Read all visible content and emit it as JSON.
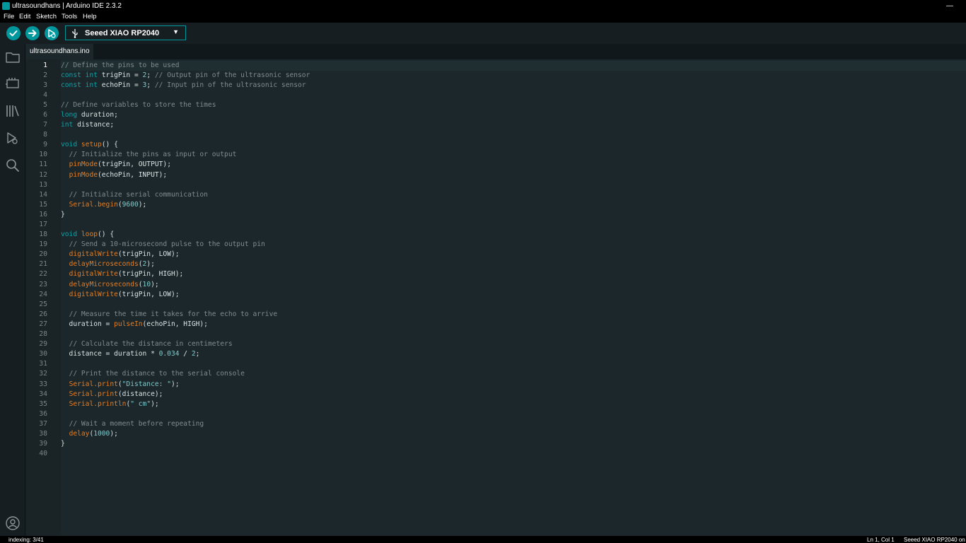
{
  "window": {
    "title": "ultrasoundhans | Arduino IDE 2.3.2",
    "minimize_glyph": "—",
    "close_glyph": "✕"
  },
  "menu": [
    "File",
    "Edit",
    "Sketch",
    "Tools",
    "Help"
  ],
  "toolbar": {
    "verify_icon": "checkmark-icon",
    "upload_icon": "arrow-right-icon",
    "debugger_icon": "debug-icon",
    "board_usb_icon": "usb-icon",
    "board_name": "Seeed XIAO RP2040",
    "board_caret": "▼"
  },
  "sidebar": {
    "items": [
      "sketchbook-icon",
      "boards-manager-icon",
      "library-manager-icon",
      "debug-icon",
      "search-icon"
    ],
    "profile_icon": "profile-icon"
  },
  "tabs": [
    {
      "label": "ultrasoundhans.ino"
    }
  ],
  "editor": {
    "active_line": 1,
    "lines": [
      [
        [
          "c",
          "// Define the pins to be used"
        ]
      ],
      [
        [
          "k",
          "const int "
        ],
        [
          "p",
          "trigPin = "
        ],
        [
          "n",
          "2"
        ],
        [
          "p",
          "; "
        ],
        [
          "c",
          "// Output pin of the ultrasonic sensor"
        ]
      ],
      [
        [
          "k",
          "const int "
        ],
        [
          "p",
          "echoPin = "
        ],
        [
          "n",
          "3"
        ],
        [
          "p",
          "; "
        ],
        [
          "c",
          "// Input pin of the ultrasonic sensor"
        ]
      ],
      [],
      [
        [
          "c",
          "// Define variables to store the times"
        ]
      ],
      [
        [
          "k",
          "long "
        ],
        [
          "p",
          "duration;"
        ]
      ],
      [
        [
          "k",
          "int "
        ],
        [
          "p",
          "distance;"
        ]
      ],
      [],
      [
        [
          "k",
          "void "
        ],
        [
          "f",
          "setup"
        ],
        [
          "p",
          "() {"
        ]
      ],
      [
        [
          "p",
          "  "
        ],
        [
          "c",
          "// Initialize the pins as input or output"
        ]
      ],
      [
        [
          "p",
          "  "
        ],
        [
          "f",
          "pinMode"
        ],
        [
          "p",
          "(trigPin, OUTPUT);"
        ]
      ],
      [
        [
          "p",
          "  "
        ],
        [
          "f",
          "pinMode"
        ],
        [
          "p",
          "(echoPin, INPUT);"
        ]
      ],
      [],
      [
        [
          "p",
          "  "
        ],
        [
          "c",
          "// Initialize serial communication"
        ]
      ],
      [
        [
          "p",
          "  "
        ],
        [
          "f",
          "Serial.begin"
        ],
        [
          "p",
          "("
        ],
        [
          "n",
          "9600"
        ],
        [
          "p",
          ");"
        ]
      ],
      [
        [
          "p",
          "}"
        ]
      ],
      [],
      [
        [
          "k",
          "void "
        ],
        [
          "f",
          "loop"
        ],
        [
          "p",
          "() {"
        ]
      ],
      [
        [
          "p",
          "  "
        ],
        [
          "c",
          "// Send a 10-microsecond pulse to the output pin"
        ]
      ],
      [
        [
          "p",
          "  "
        ],
        [
          "f",
          "digitalWrite"
        ],
        [
          "p",
          "(trigPin, LOW);"
        ]
      ],
      [
        [
          "p",
          "  "
        ],
        [
          "f",
          "delayMicroseconds"
        ],
        [
          "p",
          "("
        ],
        [
          "n",
          "2"
        ],
        [
          "p",
          ");"
        ]
      ],
      [
        [
          "p",
          "  "
        ],
        [
          "f",
          "digitalWrite"
        ],
        [
          "p",
          "(trigPin, HIGH);"
        ]
      ],
      [
        [
          "p",
          "  "
        ],
        [
          "f",
          "delayMicroseconds"
        ],
        [
          "p",
          "("
        ],
        [
          "n",
          "10"
        ],
        [
          "p",
          ");"
        ]
      ],
      [
        [
          "p",
          "  "
        ],
        [
          "f",
          "digitalWrite"
        ],
        [
          "p",
          "(trigPin, LOW);"
        ]
      ],
      [],
      [
        [
          "p",
          "  "
        ],
        [
          "c",
          "// Measure the time it takes for the echo to arrive"
        ]
      ],
      [
        [
          "p",
          "  duration = "
        ],
        [
          "f",
          "pulseIn"
        ],
        [
          "p",
          "(echoPin, HIGH);"
        ]
      ],
      [],
      [
        [
          "p",
          "  "
        ],
        [
          "c",
          "// Calculate the distance in centimeters"
        ]
      ],
      [
        [
          "p",
          "  distance = duration * "
        ],
        [
          "n",
          "0.034"
        ],
        [
          "p",
          " / "
        ],
        [
          "n",
          "2"
        ],
        [
          "p",
          ";"
        ]
      ],
      [],
      [
        [
          "p",
          "  "
        ],
        [
          "c",
          "// Print the distance to the serial console"
        ]
      ],
      [
        [
          "p",
          "  "
        ],
        [
          "f",
          "Serial.print"
        ],
        [
          "p",
          "("
        ],
        [
          "s",
          "\"Distance: \""
        ],
        [
          "p",
          ");"
        ]
      ],
      [
        [
          "p",
          "  "
        ],
        [
          "f",
          "Serial.print"
        ],
        [
          "p",
          "(distance);"
        ]
      ],
      [
        [
          "p",
          "  "
        ],
        [
          "f",
          "Serial.println"
        ],
        [
          "p",
          "("
        ],
        [
          "s",
          "\" cm\""
        ],
        [
          "p",
          ");"
        ]
      ],
      [],
      [
        [
          "p",
          "  "
        ],
        [
          "c",
          "// Wait a moment before repeating"
        ]
      ],
      [
        [
          "p",
          "  "
        ],
        [
          "f",
          "delay"
        ],
        [
          "p",
          "("
        ],
        [
          "n",
          "1000"
        ],
        [
          "p",
          ");"
        ]
      ],
      [
        [
          "p",
          "}"
        ]
      ],
      []
    ]
  },
  "status": {
    "indexing": "indexing: 3/41",
    "position": "Ln 1, Col 1",
    "board": "Seeed XIAO RP2040 on"
  },
  "colors": {
    "accent": "#00979d",
    "editor_bg": "#1c272b",
    "comment": "#7f8c8d",
    "keyword": "#0ca1a6",
    "function": "#e67e22",
    "literal": "#7fcbcd"
  }
}
